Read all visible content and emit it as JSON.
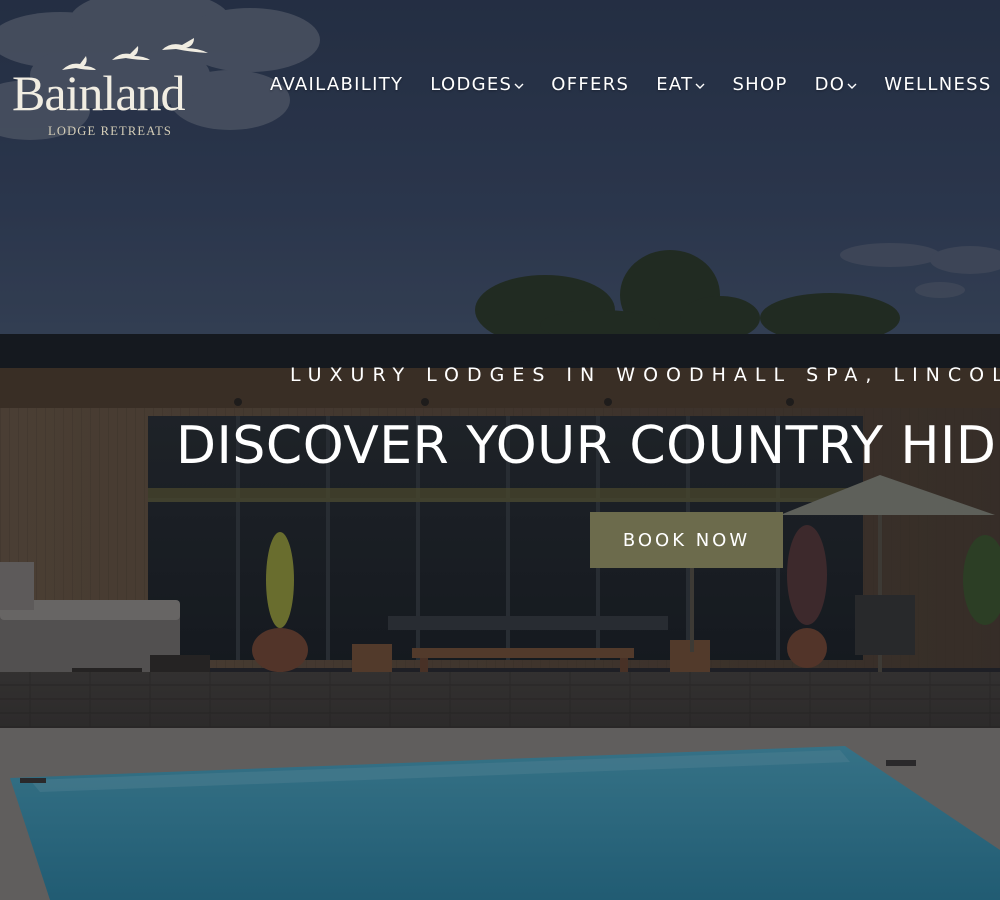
{
  "brand": {
    "name": "Bainland",
    "subtitle": "LODGE RETREATS"
  },
  "nav": {
    "items": [
      {
        "label": "AVAILABILITY",
        "dropdown": false
      },
      {
        "label": "LODGES",
        "dropdown": true
      },
      {
        "label": "OFFERS",
        "dropdown": false
      },
      {
        "label": "EAT",
        "dropdown": true
      },
      {
        "label": "SHOP",
        "dropdown": false
      },
      {
        "label": "DO",
        "dropdown": true
      },
      {
        "label": "WELLNESS",
        "dropdown": false
      }
    ]
  },
  "hero": {
    "tagline": "LUXURY LODGES IN WOODHALL SPA, LINCOLNSHIRE",
    "headline": "DISCOVER YOUR COUNTRY HIDEAWAY",
    "cta_label": "BOOK NOW",
    "cta_color": "#6c6b4c"
  },
  "icons": {
    "logo_mark": "flying-geese-icon",
    "dropdown": "chevron-down-icon"
  }
}
